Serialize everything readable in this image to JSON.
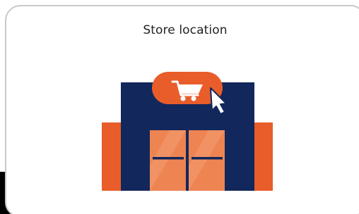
{
  "card": {
    "title": "Store location",
    "icon": "store-front-icon",
    "badge_icon": "shopping-cart-icon",
    "pointer_icon": "mouse-pointer-icon"
  },
  "colors": {
    "building": "#12275c",
    "wing": "#e85d2a",
    "door": "#ee8452",
    "door_handle": "#12275c",
    "badge": "#e85d2a",
    "card_border": "#c9c9c9",
    "title_text": "#222222"
  }
}
